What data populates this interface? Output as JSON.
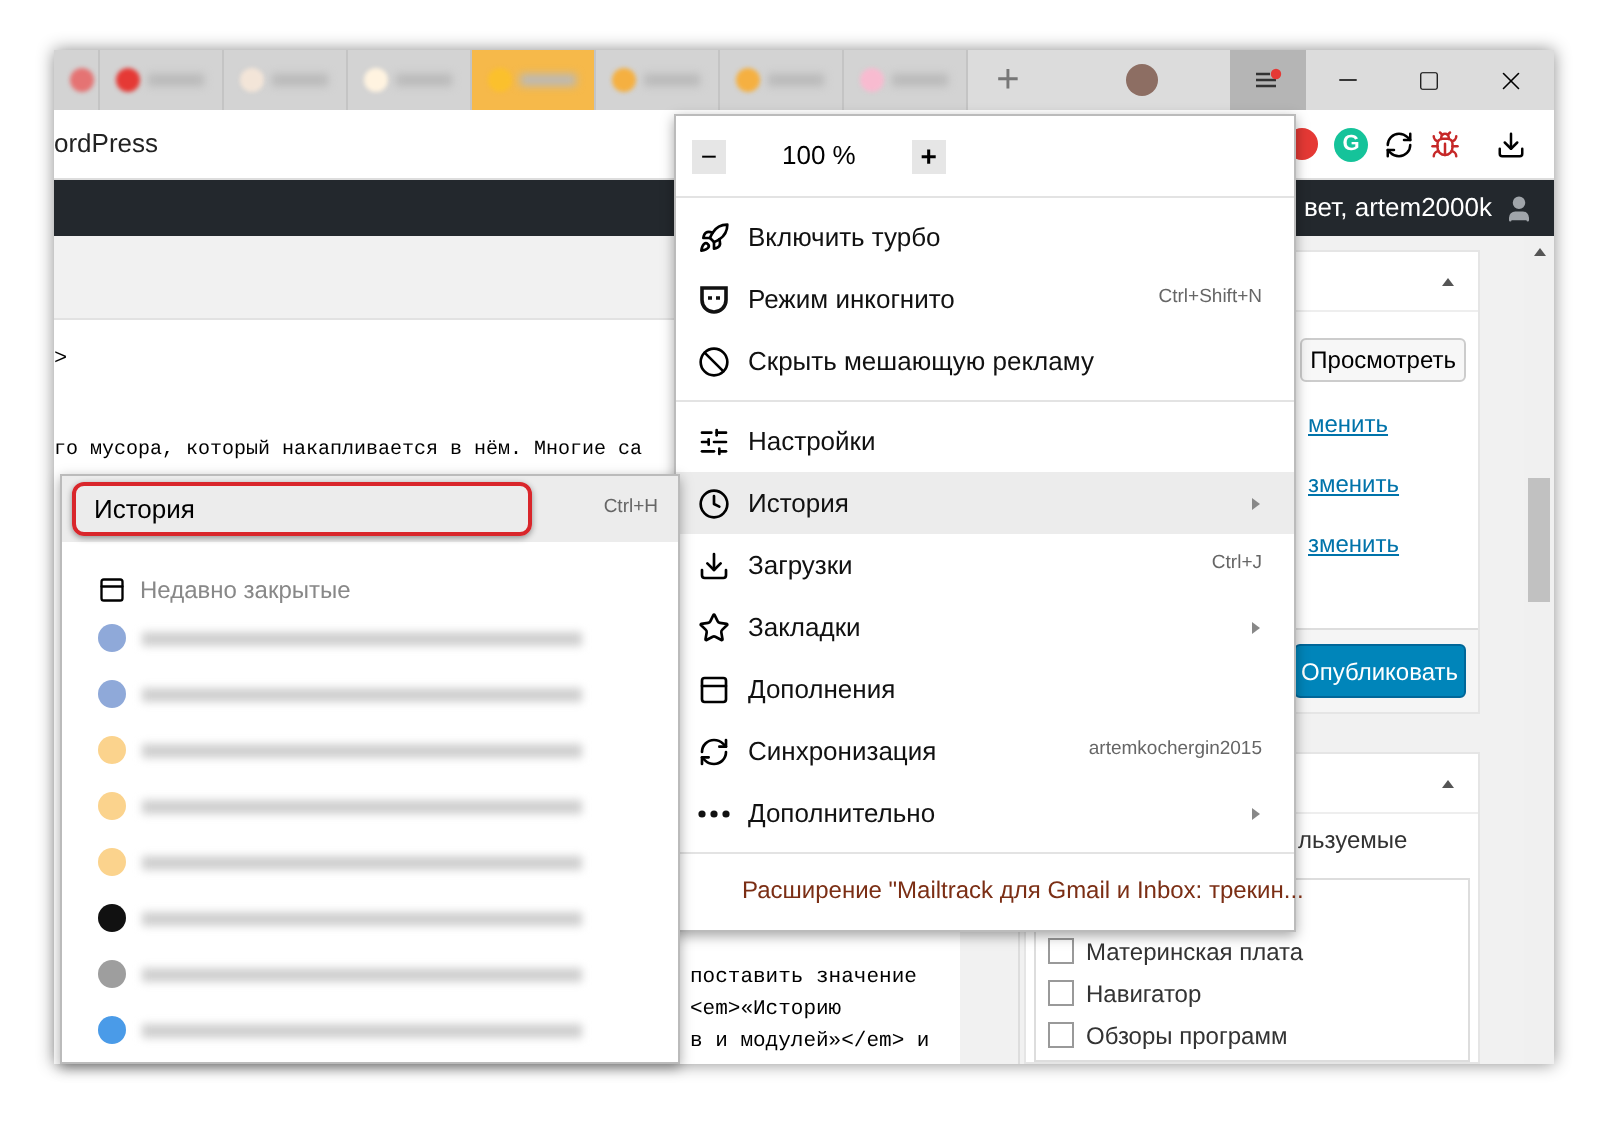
{
  "tabs": [
    {
      "color": "#e57373",
      "selected": false
    },
    {
      "color": "#e53935",
      "selected": false
    },
    {
      "color": "#f3e5d8",
      "selected": false
    },
    {
      "color": "#fff3e0",
      "selected": false
    },
    {
      "color": "#fbc02d",
      "selected": true
    },
    {
      "color": "#f5b041",
      "selected": false
    },
    {
      "color": "#f5b041",
      "selected": false
    },
    {
      "color": "#f8bbd0",
      "selected": false
    }
  ],
  "new_tab": "+",
  "address": "ordPress",
  "toolbar": {
    "badge_letter": "G"
  },
  "admin_bar": {
    "user": "вет, artem2000k"
  },
  "page": {
    "marker": ">",
    "code_line": "го мусора, который накапливается в нём. Многие са",
    "code_bottom": [
      "поставить значение",
      "<em>«Историю",
      "в и модулей»</em> и"
    ]
  },
  "side_panel": {
    "preview_button": "Просмотреть",
    "links": [
      "менить",
      "зменить",
      "зменить"
    ],
    "publish_button": "Опубликовать",
    "tab_label": "льзуемые",
    "categories": [
      {
        "label": "Материнская плата",
        "checked": false
      },
      {
        "label": "Навигатор",
        "checked": false
      },
      {
        "label": "Обзоры программ",
        "checked": false
      }
    ]
  },
  "menu": {
    "zoom": {
      "minus": "−",
      "value": "100 %",
      "plus": "+"
    },
    "groups": [
      [
        {
          "label": "Включить турбо",
          "selected": false,
          "submenu": false
        },
        {
          "label": "Режим инкогнито",
          "shortcut": "Ctrl+Shift+N",
          "selected": false,
          "submenu": false
        },
        {
          "label": "Скрыть мешающую рекламу",
          "selected": false,
          "submenu": false
        }
      ],
      [
        {
          "label": "Настройки",
          "selected": false,
          "submenu": false
        },
        {
          "label": "История",
          "selected": true,
          "submenu": true
        },
        {
          "label": "Загрузки",
          "shortcut": "Ctrl+J",
          "selected": false,
          "submenu": false
        },
        {
          "label": "Закладки",
          "selected": false,
          "submenu": true
        },
        {
          "label": "Дополнения",
          "selected": false,
          "submenu": false
        },
        {
          "label": "Синхронизация",
          "shortcut": "artemkochergin2015",
          "selected": false,
          "submenu": false
        },
        {
          "label": "Дополнительно",
          "selected": false,
          "submenu": true
        }
      ]
    ],
    "extension": "Расширение \"Mailtrack для Gmail и Inbox: трекин..."
  },
  "history": {
    "title": "История",
    "shortcut": "Ctrl+H",
    "highlighted": true,
    "recent": "Недавно закрытые",
    "entries": [
      {
        "color": "#8fa9d9"
      },
      {
        "color": "#8fa9d9"
      },
      {
        "color": "#fbd38d"
      },
      {
        "color": "#fbd38d"
      },
      {
        "color": "#fbd38d"
      },
      {
        "color": "#111111"
      },
      {
        "color": "#9e9e9e"
      },
      {
        "color": "#4a9be8"
      }
    ]
  }
}
